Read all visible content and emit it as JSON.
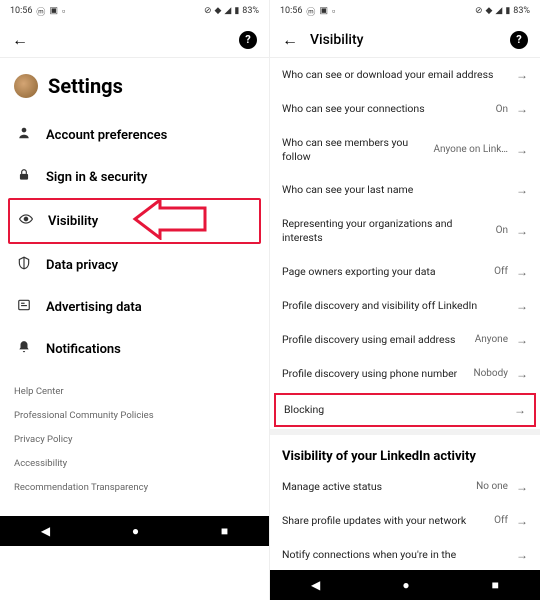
{
  "statusbar": {
    "time": "10:56",
    "battery": "83%"
  },
  "left": {
    "title": "Settings",
    "menu": [
      {
        "icon": "person",
        "label": "Account preferences"
      },
      {
        "icon": "lock",
        "label": "Sign in & security"
      },
      {
        "icon": "eye",
        "label": "Visibility"
      },
      {
        "icon": "shield",
        "label": "Data privacy"
      },
      {
        "icon": "news",
        "label": "Advertising data"
      },
      {
        "icon": "bell",
        "label": "Notifications"
      }
    ],
    "footer": [
      "Help Center",
      "Professional Community Policies",
      "Privacy Policy",
      "Accessibility",
      "Recommendation Transparency"
    ]
  },
  "right": {
    "title": "Visibility",
    "items": [
      {
        "label": "Who can see or download your email address",
        "value": ""
      },
      {
        "label": "Who can see your connections",
        "value": "On"
      },
      {
        "label": "Who can see members you follow",
        "value": "Anyone on Link…"
      },
      {
        "label": "Who can see your last name",
        "value": ""
      },
      {
        "label": "Representing your organizations and interests",
        "value": "On"
      },
      {
        "label": "Page owners exporting your data",
        "value": "Off"
      },
      {
        "label": "Profile discovery and visibility off LinkedIn",
        "value": ""
      },
      {
        "label": "Profile discovery using email address",
        "value": "Anyone"
      },
      {
        "label": "Profile discovery using phone number",
        "value": "Nobody"
      },
      {
        "label": "Blocking",
        "value": ""
      }
    ],
    "section2_title": "Visibility of your LinkedIn activity",
    "section2_items": [
      {
        "label": "Manage active status",
        "value": "No one"
      },
      {
        "label": "Share profile updates with your network",
        "value": "Off"
      },
      {
        "label": "Notify connections when you're in the",
        "value": ""
      }
    ]
  }
}
